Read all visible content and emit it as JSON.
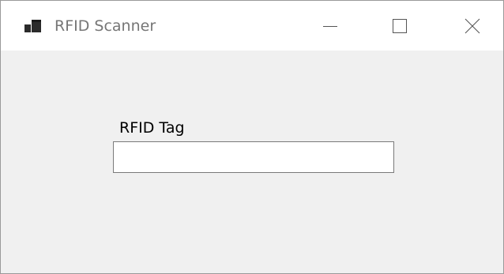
{
  "window": {
    "title": "RFID Scanner",
    "icon": "app-window-icon",
    "controls": {
      "minimize_icon": "minimize-icon",
      "maximize_icon": "maximize-icon",
      "close_icon": "close-icon"
    }
  },
  "form": {
    "rfid_label": "RFID Tag",
    "rfid_value": "",
    "rfid_placeholder": ""
  },
  "colors": {
    "titlebar_bg": "#ffffff",
    "client_bg": "#f0f0f0",
    "title_text": "#767676",
    "border": "#9a9a9a",
    "input_border": "#7a7a7a"
  }
}
